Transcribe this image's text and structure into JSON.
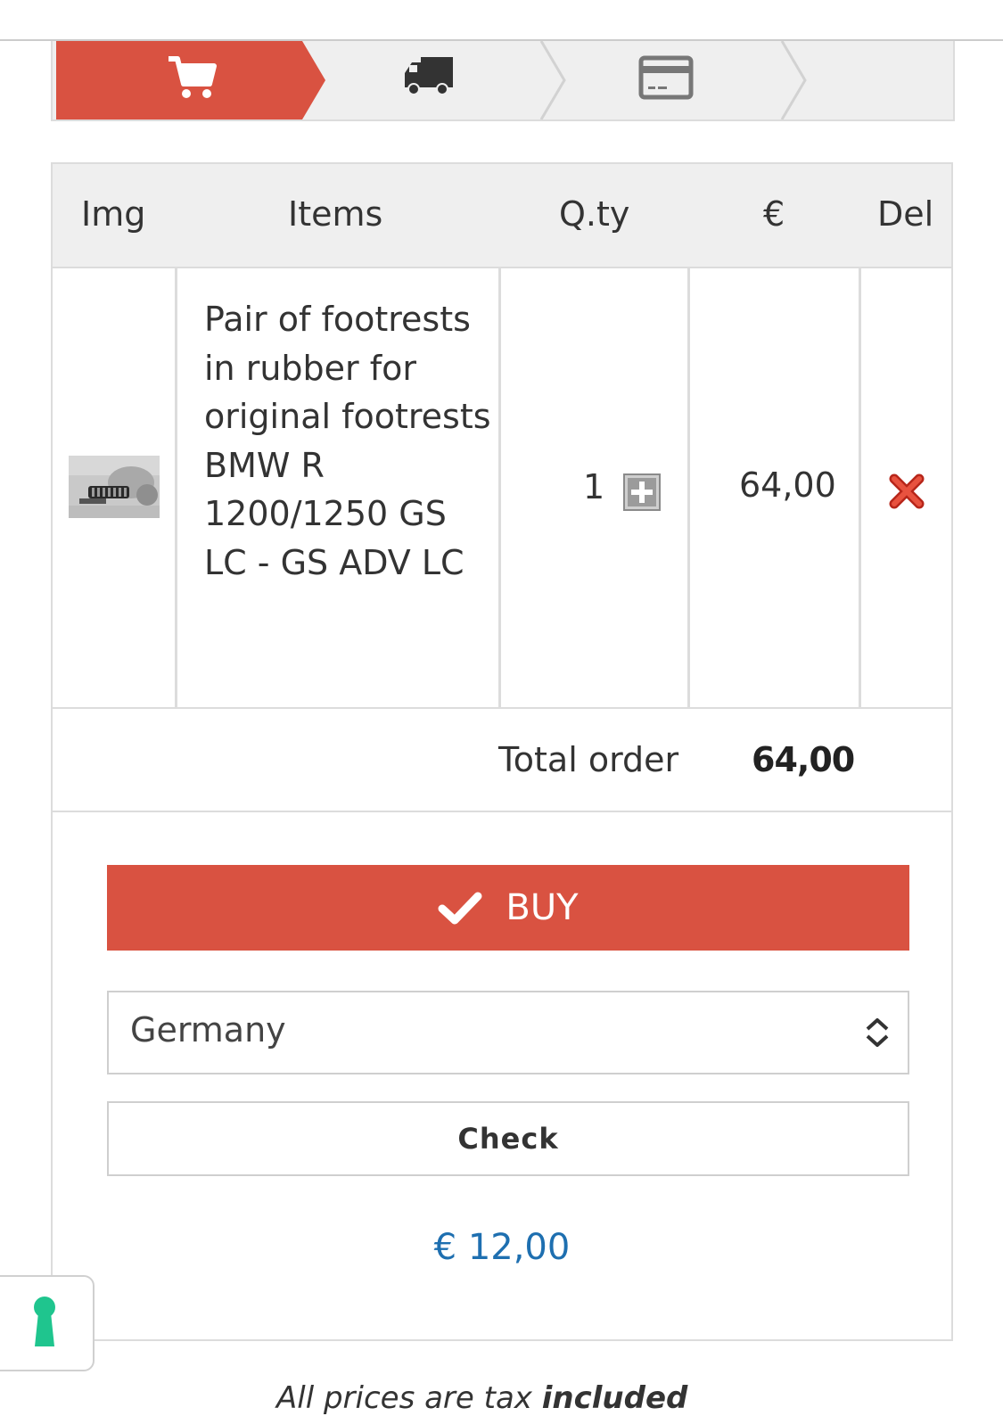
{
  "steps": [
    {
      "icon": "cart-icon",
      "state": "active"
    },
    {
      "icon": "truck-icon",
      "state": "inactive"
    },
    {
      "icon": "credit-card-icon",
      "state": "inactive"
    }
  ],
  "colors": {
    "accent": "#d95241",
    "link": "#1e6fb0",
    "header_bg": "#efefef",
    "success": "#1fc58e"
  },
  "table": {
    "headers": {
      "img": "Img",
      "items": "Items",
      "qty": "Q.ty",
      "price": "€",
      "del": "Del"
    },
    "rows": [
      {
        "name": "Pair of footrests in rubber for original footrests BMW R 1200/1250 GS LC - GS ADV LC",
        "qty": "1",
        "price": "64,00"
      }
    ]
  },
  "total": {
    "label": "Total order",
    "value": "64,00"
  },
  "buy_button": {
    "label": "BUY"
  },
  "shipping": {
    "country": "Germany",
    "check_label": "Check",
    "cost": "€ 12,00"
  },
  "footnote": {
    "text": "All prices are tax ",
    "bold": "included"
  }
}
